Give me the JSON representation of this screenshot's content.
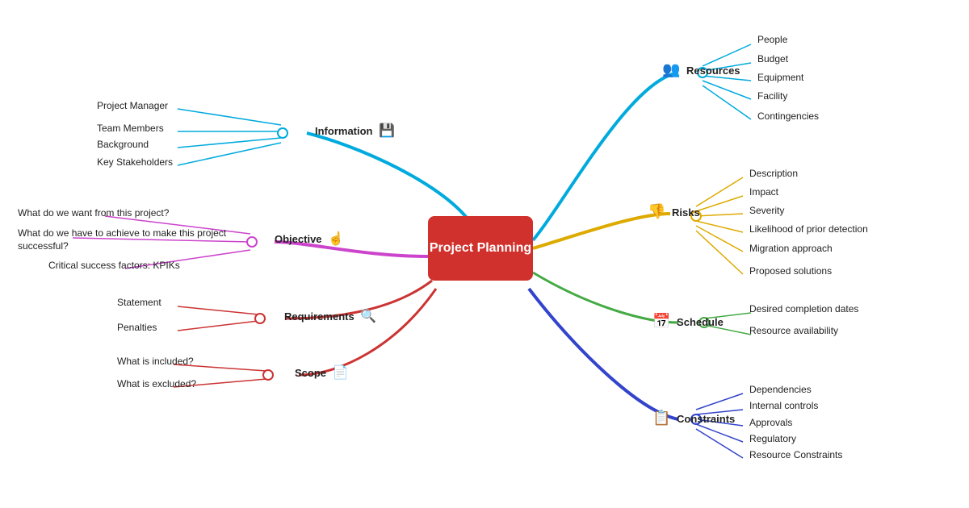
{
  "center": {
    "label": "Project\nPlanning"
  },
  "branches": {
    "information": {
      "label": "Information",
      "color": "#00aadd",
      "icon": "💾",
      "leaves": [
        "Project Manager",
        "Team Members",
        "Background",
        "Key Stakeholders"
      ]
    },
    "objective": {
      "label": "Objective",
      "color": "#cc44cc",
      "icon": "☝",
      "leaves": [
        "What do we want from this project?",
        "What do we have to\nachieve to make this project successful?",
        "Critical success factors: KPIKs"
      ]
    },
    "requirements": {
      "label": "Requirements",
      "color": "#cc3333",
      "icon": "🔍",
      "leaves": [
        "Statement",
        "Penalties"
      ]
    },
    "scope": {
      "label": "Scope",
      "color": "#cc3333",
      "icon": "📄",
      "leaves": [
        "What is included?",
        "What is excluded?"
      ]
    },
    "resources": {
      "label": "Resources",
      "color": "#00aadd",
      "icon": "👥",
      "leaves": [
        "People",
        "Budget",
        "Equipment",
        "Facility",
        "Contingencies"
      ]
    },
    "risks": {
      "label": "Risks",
      "color": "#ddaa00",
      "icon": "👎",
      "leaves": [
        "Description",
        "Impact",
        "Severity",
        "Likelihood of prior detection",
        "Migration approach",
        "Proposed solutions"
      ]
    },
    "schedule": {
      "label": "Schedule",
      "color": "#44aa44",
      "icon": "📅",
      "leaves": [
        "Desired completion dates",
        "Resource availability"
      ]
    },
    "constraints": {
      "label": "Constraints",
      "color": "#3344cc",
      "icon": "📋",
      "leaves": [
        "Dependencies",
        "Internal controls",
        "Approvals",
        "Regulatory",
        "Resource Constraints"
      ]
    }
  }
}
